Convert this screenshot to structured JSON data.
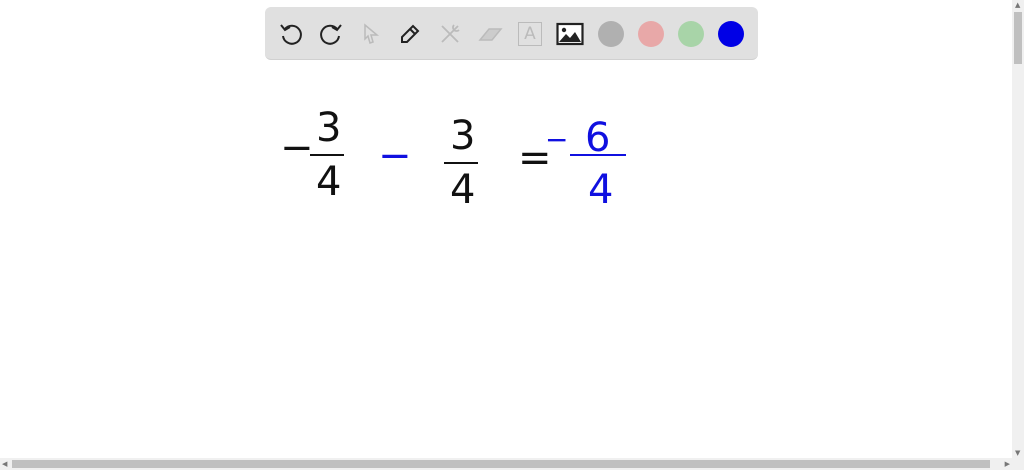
{
  "toolbar": {
    "tools": [
      "undo-icon",
      "redo-icon",
      "select-icon",
      "pen-icon",
      "tools-icon",
      "eraser-icon",
      "text-icon",
      "image-icon"
    ],
    "text_tool_label": "A",
    "colors": [
      "#b0b0b0",
      "#e8a8a8",
      "#a8d4a8",
      "#0000e6"
    ]
  },
  "math": {
    "term1_sign": "−",
    "term1_num": "3",
    "term1_den": "4",
    "operator": "−",
    "term2_num": "3",
    "term2_den": "4",
    "equals": "=",
    "result_sign": "−",
    "result_num": "6",
    "result_den": "4",
    "ink_black": "#111111",
    "ink_blue": "#1010e0"
  }
}
